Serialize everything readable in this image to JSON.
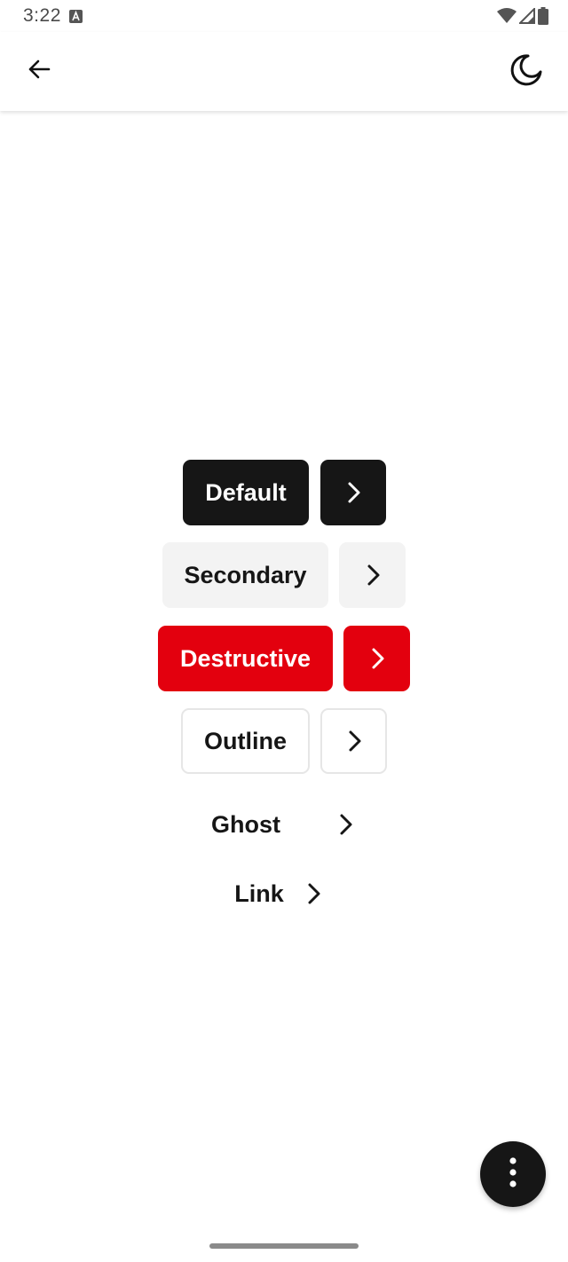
{
  "status_bar": {
    "time": "3:22",
    "icons": [
      "keyboard-a-icon",
      "wifi-icon",
      "signal-icon",
      "battery-icon"
    ]
  },
  "app_bar": {
    "back_icon": "arrow-back-icon",
    "theme_icon": "moon-icon"
  },
  "buttons": [
    {
      "variant": "default",
      "label": "Default",
      "icon": "chevron-right-icon"
    },
    {
      "variant": "secondary",
      "label": "Secondary",
      "icon": "chevron-right-icon"
    },
    {
      "variant": "destructive",
      "label": "Destructive",
      "icon": "chevron-right-icon"
    },
    {
      "variant": "outline",
      "label": "Outline",
      "icon": "chevron-right-icon"
    },
    {
      "variant": "ghost",
      "label": "Ghost",
      "icon": "chevron-right-icon"
    },
    {
      "variant": "link",
      "label": "Link",
      "icon": "chevron-right-icon"
    }
  ],
  "fab": {
    "icon": "more-vertical-icon"
  },
  "colors": {
    "default": "#161616",
    "secondary": "#f3f3f3",
    "destructive": "#e3000e",
    "outline_border": "#e6e6e6"
  }
}
